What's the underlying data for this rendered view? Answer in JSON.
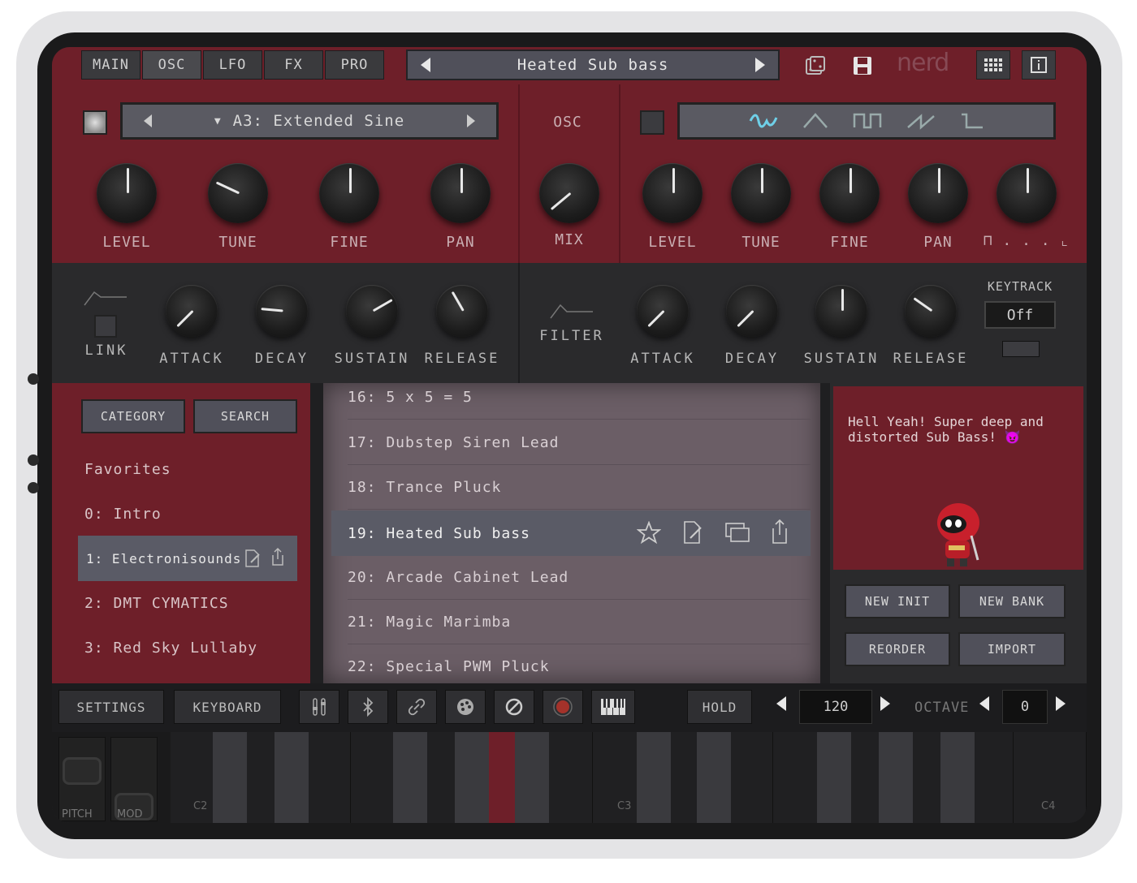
{
  "tabs": [
    "MAIN",
    "OSC",
    "LFO",
    "FX",
    "PRO"
  ],
  "active_tab": "OSC",
  "preset": {
    "name": "Heated Sub bass"
  },
  "brand": "nerd",
  "osc1": {
    "waveform": "A3: Extended Sine",
    "knobs": [
      "LEVEL",
      "TUNE",
      "FINE",
      "PAN"
    ]
  },
  "osc_mix": {
    "header": "OSC",
    "knob": "MIX"
  },
  "osc2": {
    "waveforms": [
      "sine-wave-icon",
      "triangle-wave-icon",
      "square-wave-icon",
      "saw-wave-icon",
      "pulse-wave-icon"
    ],
    "knobs": [
      "LEVEL",
      "TUNE",
      "FINE",
      "PAN"
    ],
    "pulse_label": "⊓ . . . ⌞"
  },
  "amp_env": {
    "link_label": "LINK",
    "knobs": [
      "ATTACK",
      "DECAY",
      "SUSTAIN",
      "RELEASE"
    ]
  },
  "filter_env": {
    "label": "FILTER",
    "knobs": [
      "ATTACK",
      "DECAY",
      "SUSTAIN",
      "RELEASE"
    ],
    "keytrack_label": "KEYTRACK",
    "keytrack_value": "Off"
  },
  "browser": {
    "category_button": "CATEGORY",
    "search_button": "SEARCH",
    "categories": [
      "Favorites",
      "0: Intro",
      "1: Electronisounds",
      "2: DMT CYMATICS",
      "3: Red Sky Lullaby"
    ],
    "selected_category": "1: Electronisounds",
    "presets": [
      "16: 5 x 5 = 5",
      "17: Dubstep Siren Lead",
      "18: Trance Pluck",
      "19: Heated Sub bass",
      "20: Arcade Cabinet Lead",
      "21: Magic Marimba",
      "22: Special PWM Pluck"
    ],
    "selected_preset": "19: Heated Sub bass",
    "description": "Hell Yeah! Super deep and distorted Sub Bass! 😈",
    "new_init": "NEW INIT",
    "new_bank": "NEW BANK",
    "reorder": "REORDER",
    "import": "IMPORT"
  },
  "toolbar": {
    "settings": "SETTINGS",
    "keyboard": "KEYBOARD",
    "hold": "HOLD",
    "tempo": "120",
    "octave_label": "OCTAVE",
    "octave_value": "0"
  },
  "keys": {
    "pitch": "PITCH",
    "mod": "MOD",
    "notes": [
      "C2",
      "C3",
      "C4"
    ]
  },
  "colors": {
    "panel_red": "#6e1f29",
    "dark": "#2a2a2c",
    "highlight": "#5a5b66"
  }
}
